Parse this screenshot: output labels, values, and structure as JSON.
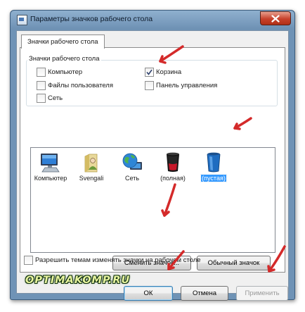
{
  "window": {
    "title": "Параметры значков рабочего стола",
    "close_symbol": "✕"
  },
  "tab": {
    "label": "Значки рабочего стола"
  },
  "group": {
    "legend": "Значки рабочего стола",
    "checkboxes": [
      {
        "label": "Компьютер",
        "checked": false
      },
      {
        "label": "Корзина",
        "checked": true
      },
      {
        "label": "Файлы пользователя",
        "checked": false
      },
      {
        "label": "Панель управления",
        "checked": false
      },
      {
        "label": "Сеть",
        "checked": false
      }
    ]
  },
  "icons": [
    {
      "label": "Компьютер",
      "icon": "computer-icon",
      "selected": false
    },
    {
      "label": "Svengali",
      "icon": "user-folder-icon",
      "selected": false
    },
    {
      "label": "Сеть",
      "icon": "network-globe-icon",
      "selected": false
    },
    {
      "label": "(полная)",
      "icon": "recycle-bin-full-icon",
      "selected": false
    },
    {
      "label": "(пустая)",
      "icon": "recycle-bin-empty-icon",
      "selected": true
    }
  ],
  "buttons": {
    "change_icon": "Сменить значок...",
    "default_icon": "Обычный значок",
    "ok": "ОК",
    "cancel": "Отмена",
    "apply": "Применить"
  },
  "themes_checkbox": {
    "label": "Разрешить темам изменять значки на рабочем столе",
    "checked": false
  },
  "watermark": "OPTIMAKOMP.RU",
  "colors": {
    "annotation_arrow": "#d42a2a",
    "selection": "#3399ff",
    "titlebar": "#7c9ec1",
    "close_button": "#c7412b"
  }
}
